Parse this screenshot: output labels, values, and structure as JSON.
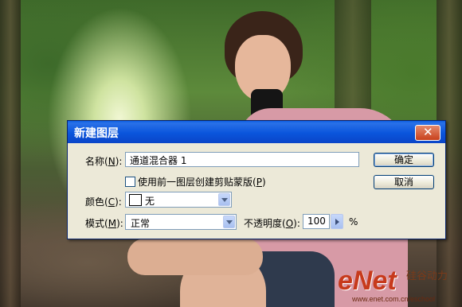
{
  "dialog": {
    "title": "新建图层",
    "name_label": "名称",
    "name_key": "N",
    "name_value": "通道混合器 1",
    "clipping_checkbox_label": "使用前一图层创建剪贴蒙版",
    "clipping_checkbox_key": "P",
    "clipping_checked": false,
    "color_label": "颜色",
    "color_key": "C",
    "color_value": "无",
    "mode_label": "模式",
    "mode_key": "M",
    "mode_value": "正常",
    "opacity_label": "不透明度",
    "opacity_key": "O",
    "opacity_value": "100",
    "percent_sign": "%",
    "ok_label": "确定",
    "cancel_label": "取消",
    "close_glyph": "✕"
  },
  "watermark": {
    "logo": "eNet",
    "cn": "硅谷动力",
    "url": "www.enet.com.cn/eschool"
  },
  "colors": {
    "titlebar": "#0a55dc",
    "dialog_bg": "#ece9d8",
    "close_button": "#c8411c"
  }
}
